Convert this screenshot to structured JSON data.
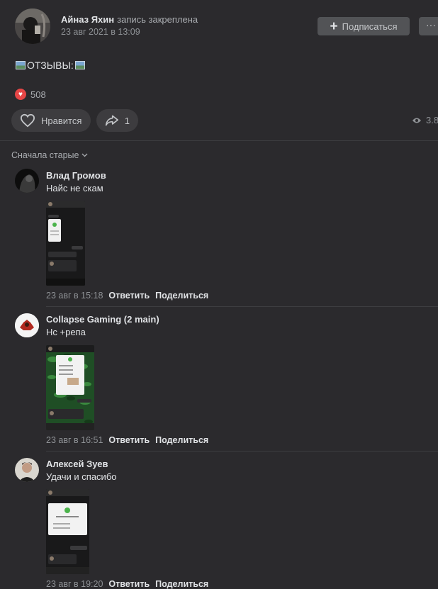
{
  "post": {
    "author_name": "Айназ Яхин",
    "pinned_label": "запись закреплена",
    "date": "23 авг 2021 в 13:09",
    "subscribe_label": "Подписаться",
    "more_label": "···",
    "text": "ОТЗЫВЫ:",
    "like_summary_count": "508",
    "like_label": "Нравится",
    "share_count": "1",
    "views": "3.8"
  },
  "comments_sort_label": "Сначала старые",
  "comments": [
    {
      "author": "Влад Громов",
      "text": "Найс не скам",
      "date": "23 авг в 15:18",
      "reply": "Ответить",
      "share": "Поделиться"
    },
    {
      "author": "Collapse Gaming (2 main)",
      "text": "Нс +репа",
      "date": "23 авг в 16:51",
      "reply": "Ответить",
      "share": "Поделиться"
    },
    {
      "author": "Алексей Зуев",
      "text": "Удачи и спасибо",
      "date": "23 авг в 19:20",
      "reply": "Ответить",
      "share": "Поделиться"
    }
  ],
  "colors": {
    "background": "#2b2a2d",
    "button": "#525356",
    "heart": "#e64646"
  },
  "icons": [
    "plus-icon",
    "more-icon",
    "heart-icon",
    "share-icon",
    "eye-icon",
    "chevron-down-icon"
  ]
}
